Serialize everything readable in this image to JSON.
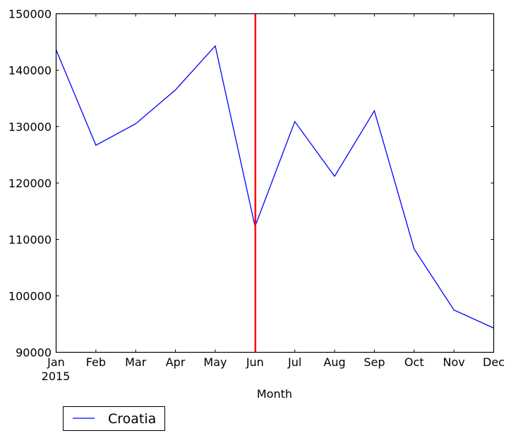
{
  "chart_data": {
    "type": "line",
    "title": "",
    "xlabel": "Month",
    "ylabel": "",
    "categories": [
      "Jan",
      "Feb",
      "Mar",
      "Apr",
      "May",
      "Jun",
      "Jul",
      "Aug",
      "Sep",
      "Oct",
      "Nov",
      "Dec"
    ],
    "x_sublabel": "2015",
    "series": [
      {
        "name": "Croatia",
        "color": "#0000ff",
        "values": [
          143600,
          126700,
          130500,
          136500,
          144300,
          112300,
          130900,
          121200,
          132800,
          108300,
          97500,
          94300
        ]
      }
    ],
    "vertical_marker": {
      "category": "Jun",
      "color": "#ff0000"
    },
    "ylim": [
      90000,
      150000
    ],
    "yticks": [
      90000,
      100000,
      110000,
      120000,
      130000,
      140000,
      150000
    ],
    "ytick_labels": [
      "90000",
      "100000",
      "110000",
      "120000",
      "130000",
      "140000",
      "150000"
    ],
    "grid": false,
    "legend": {
      "placement": "bottom-left-outside",
      "entries": [
        "Croatia"
      ]
    }
  }
}
